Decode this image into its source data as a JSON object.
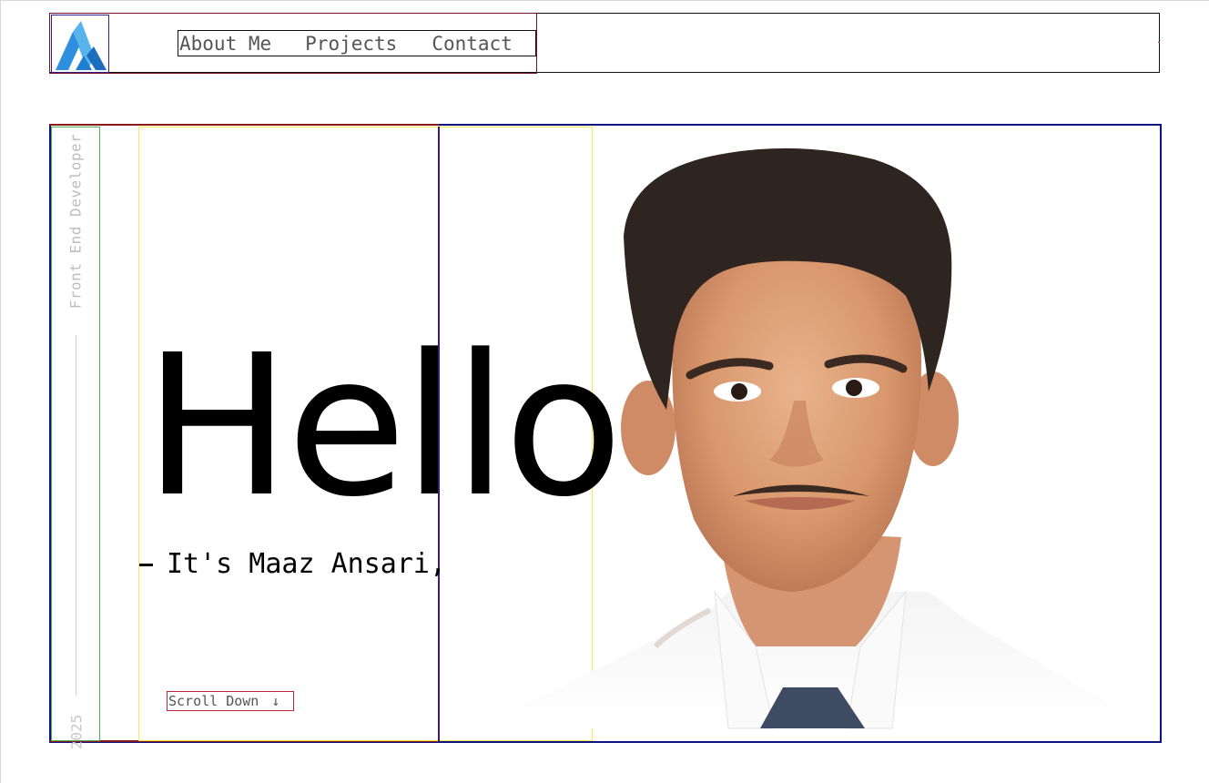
{
  "header": {
    "logo_alt": "AM logo",
    "nav": [
      {
        "label": "About Me"
      },
      {
        "label": "Projects"
      },
      {
        "label": "Contact"
      }
    ]
  },
  "hero": {
    "side_title": "Front End Developer",
    "year": "2025",
    "greeting": "Hello",
    "intro": "It's Maaz Ansari,",
    "scroll_label": "Scroll Down",
    "scroll_icon": "arrow-down-icon",
    "portrait_alt": "Portrait photo"
  },
  "colors": {
    "logo_light": "#5ab4ec",
    "logo_dark": "#1e7fd0",
    "text_muted": "#555555",
    "side_text": "#bdbdbd"
  }
}
